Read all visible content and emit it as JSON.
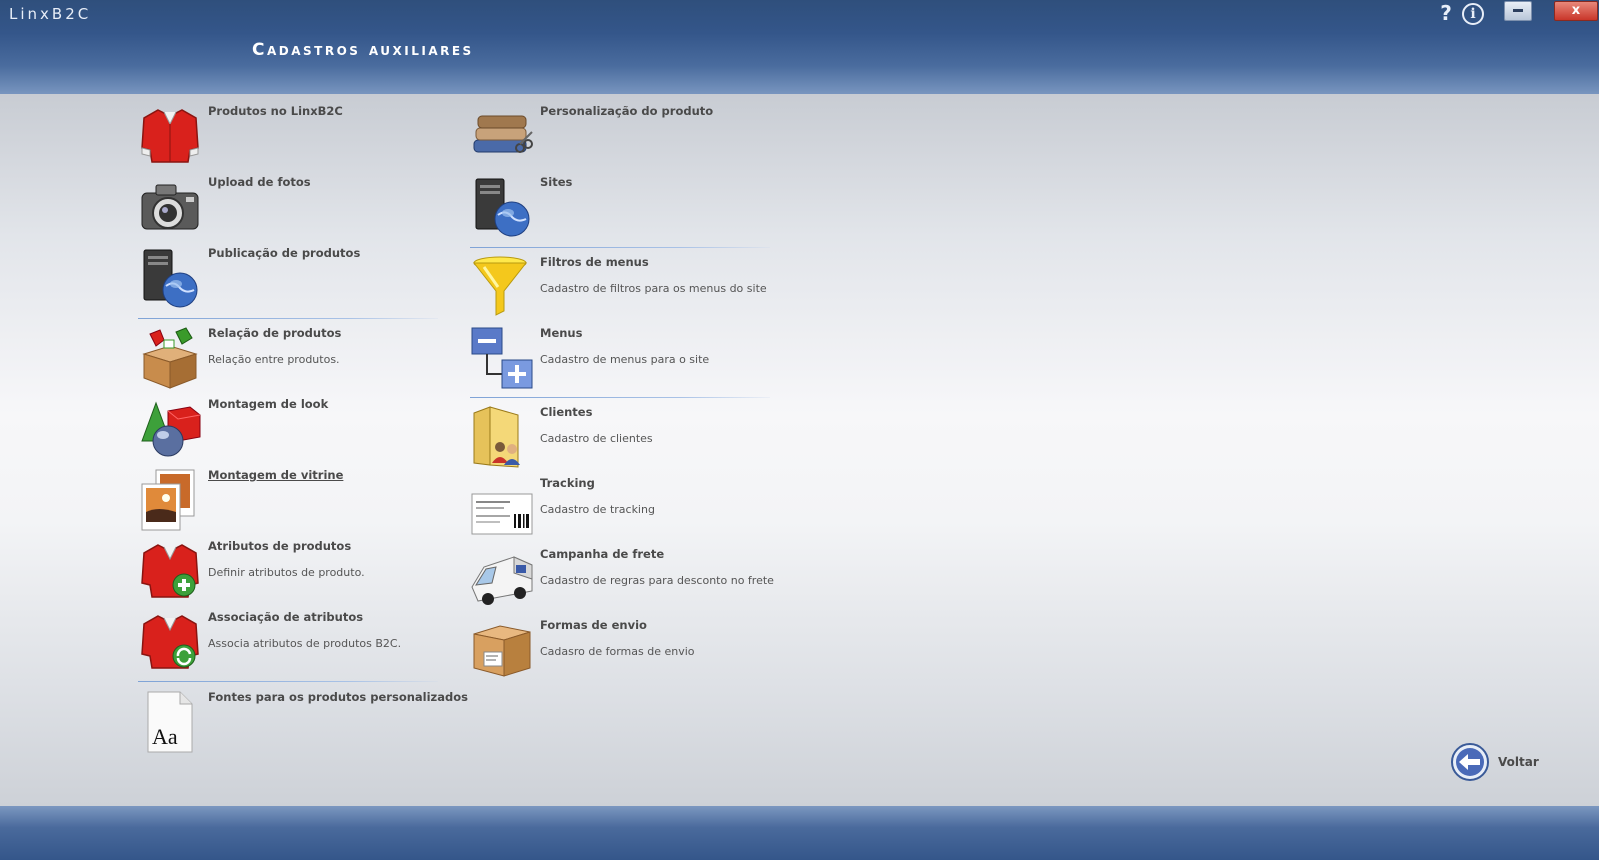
{
  "app": {
    "name": "LinxB2C"
  },
  "page": {
    "title": "Cadastros auxiliares"
  },
  "window": {
    "help": "?",
    "info": "i",
    "close": "x"
  },
  "left_column": [
    {
      "title": "Produtos no LinxB2C",
      "desc": "",
      "icon": "red-shirt-icon"
    },
    {
      "title": "Upload de fotos",
      "desc": "",
      "icon": "camera-icon"
    },
    {
      "title": "Publicação de produtos",
      "desc": "",
      "icon": "server-globe-icon"
    },
    {
      "title": "Relação de produtos",
      "desc": "Relação entre produtos.",
      "icon": "box-relation-icon"
    },
    {
      "title": "Montagem de look",
      "desc": "",
      "icon": "shapes-icon"
    },
    {
      "title": "Montagem de vitrine",
      "desc": "",
      "icon": "photos-icon"
    },
    {
      "title": "Atributos de produtos",
      "desc": "Definir atributos de produto.",
      "icon": "shirt-add-icon"
    },
    {
      "title": "Associação de atributos",
      "desc": "Associa atributos de produtos B2C.",
      "icon": "shirt-refresh-icon"
    },
    {
      "title": "Fontes para os produtos personalizados",
      "desc": "",
      "icon": "font-file-icon",
      "glyph": "Aa"
    }
  ],
  "right_column": [
    {
      "title": "Personalização do produto",
      "desc": "",
      "icon": "fabric-scissors-icon"
    },
    {
      "title": "Sites",
      "desc": "",
      "icon": "server-globe-icon"
    },
    {
      "title": "Filtros de menus",
      "desc": "Cadastro de filtros para os menus do site",
      "icon": "funnel-icon"
    },
    {
      "title": "Menus",
      "desc": "Cadastro de menus para o site",
      "icon": "menu-tree-icon"
    },
    {
      "title": "Clientes",
      "desc": "Cadastro de clientes",
      "icon": "folder-users-icon"
    },
    {
      "title": "Tracking",
      "desc": "Cadastro de tracking",
      "icon": "tracking-label-icon"
    },
    {
      "title": "Campanha de frete",
      "desc": "Cadastro de regras para desconto no frete",
      "icon": "delivery-truck-icon"
    },
    {
      "title": "Formas de envio",
      "desc": "Cadasro de formas de envio",
      "icon": "package-icon"
    }
  ],
  "back": {
    "label": "Voltar",
    "icon": "back-arrow-icon"
  }
}
